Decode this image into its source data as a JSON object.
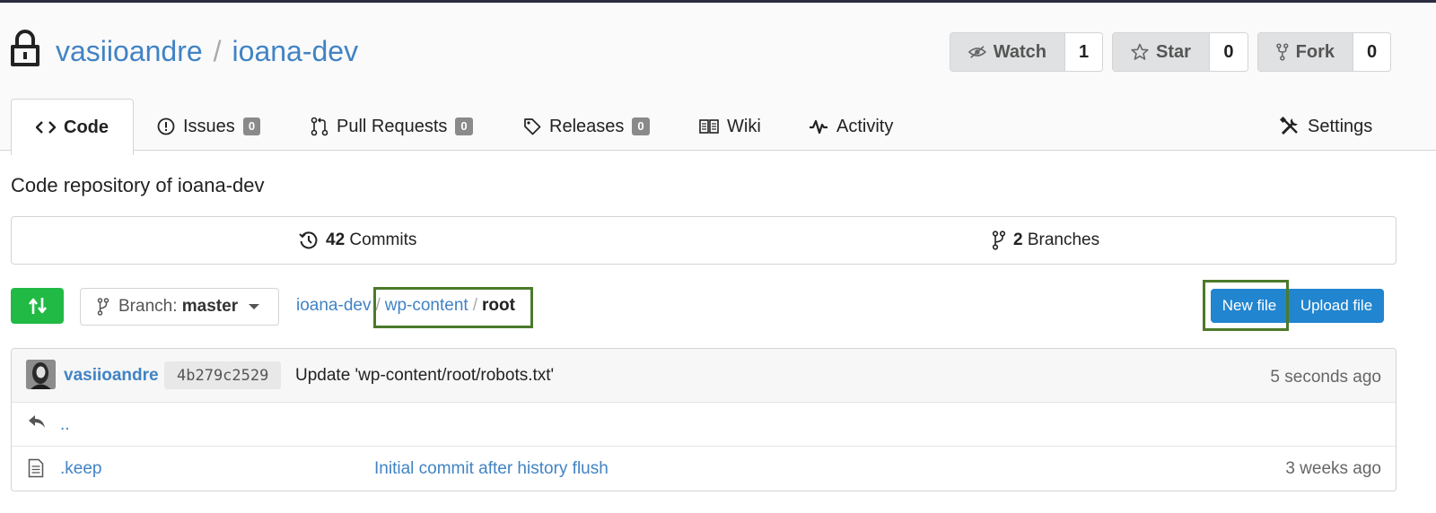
{
  "header": {
    "owner": "vasiioandre",
    "separator": "/",
    "repo": "ioana-dev",
    "watch": {
      "label": "Watch",
      "count": "1"
    },
    "star": {
      "label": "Star",
      "count": "0"
    },
    "fork": {
      "label": "Fork",
      "count": "0"
    }
  },
  "tabs": [
    {
      "label": "Code",
      "icon": "code-icon"
    },
    {
      "label": "Issues",
      "badge": "0",
      "icon": "issue-icon"
    },
    {
      "label": "Pull Requests",
      "badge": "0",
      "icon": "pull-request-icon"
    },
    {
      "label": "Releases",
      "badge": "0",
      "icon": "tag-icon"
    },
    {
      "label": "Wiki",
      "icon": "book-icon"
    },
    {
      "label": "Activity",
      "icon": "pulse-icon"
    },
    {
      "label": "Settings",
      "icon": "tools-icon"
    }
  ],
  "description": "Code repository of ioana-dev",
  "stats": {
    "commits": {
      "count": "42",
      "label": "Commits"
    },
    "branches": {
      "count": "2",
      "label": "Branches"
    }
  },
  "toolbar": {
    "branch_prefix": "Branch:",
    "branch": "master",
    "breadcrumb": [
      "ioana-dev",
      "wp-content",
      "root"
    ],
    "new_file": "New file",
    "upload_file": "Upload file"
  },
  "latest_commit": {
    "author": "vasiioandre",
    "sha": "4b279c2529",
    "message": "Update 'wp-content/root/robots.txt'",
    "time": "5 seconds ago"
  },
  "files": [
    {
      "name": "..",
      "type": "parent"
    },
    {
      "name": ".keep",
      "type": "file",
      "commit": "Initial commit after history flush",
      "time": "3 weeks ago"
    }
  ],
  "colors": {
    "link": "#4183c4",
    "primary_button": "#2185d0",
    "sync_button": "#21ba45",
    "highlight_box": "#4b7a2b"
  }
}
